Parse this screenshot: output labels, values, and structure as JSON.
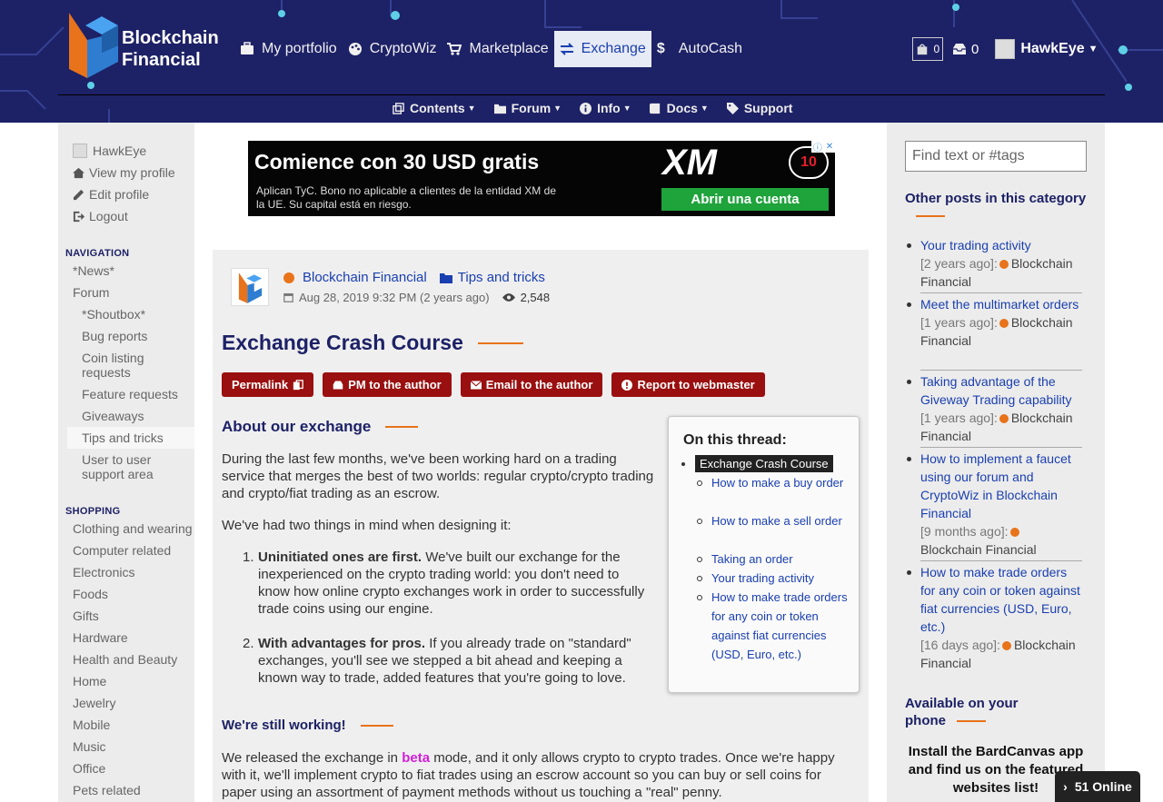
{
  "header": {
    "brand_line1": "Blockchain",
    "brand_line2": "Financial",
    "topnav": [
      {
        "label": "My portfolio",
        "icon": "briefcase-icon"
      },
      {
        "label": "CryptoWiz",
        "icon": "palette-icon"
      },
      {
        "label": "Marketplace",
        "icon": "cart-icon"
      },
      {
        "label": "Exchange",
        "icon": "exchange-icon",
        "active": true
      },
      {
        "label": "AutoCash",
        "icon": "dollar-icon"
      }
    ],
    "cart_count": "0",
    "messages_count": "0",
    "username": "HawkEye",
    "subnav": [
      {
        "label": "Contents",
        "icon": "clone-icon"
      },
      {
        "label": "Forum",
        "icon": "folder-icon"
      },
      {
        "label": "Info",
        "icon": "info-icon"
      },
      {
        "label": "Docs",
        "icon": "book-icon"
      },
      {
        "label": "Support",
        "icon": "tag-icon"
      }
    ],
    "colors": {
      "header_bg": "#1d2166",
      "accent_orange": "#e8731a",
      "button_red": "#9a0f0f"
    }
  },
  "left_sidebar": {
    "user": {
      "name": "HawkEye",
      "view_profile": "View my profile",
      "edit_profile": "Edit profile",
      "logout": "Logout"
    },
    "navigation_heading": "NAVIGATION",
    "navigation": [
      "*News*",
      "Forum",
      "*Shoutbox*",
      "Bug reports",
      "Coin listing requests",
      "Feature requests",
      "Giveaways",
      "Tips and tricks",
      "User to user support area"
    ],
    "shopping_heading": "SHOPPING",
    "shopping": [
      "Clothing and wearing",
      "Computer related",
      "Electronics",
      "Foods",
      "Gifts",
      "Hardware",
      "Health and Beauty",
      "Home",
      "Jewelry",
      "Mobile",
      "Music",
      "Office",
      "Pets related"
    ]
  },
  "ad": {
    "title": "Comience con 30 USD gratis",
    "subtitle": "Aplican TyC. Bono no aplicable a clientes de la entidad XM de la UE. Su capital está en riesgo.",
    "brand": "XM",
    "button": "Abrir una cuenta",
    "badge": "10"
  },
  "post": {
    "author": "Blockchain Financial",
    "category": "Tips and tricks",
    "date": "Aug 28, 2019 9:32 PM (2 years ago)",
    "views": "2,548",
    "title": "Exchange Crash Course",
    "buttons": {
      "permalink": "Permalink",
      "pm": "PM to the author",
      "email": "Email to the author",
      "report": "Report to webmaster"
    },
    "section1_heading": "About our exchange",
    "para1": "During the last few months, we've been working hard on a trading service that merges the best of two worlds: regular crypto/crypto trading and crypto/fiat trading as an escrow.",
    "para2": "We've had two things in mind when designing it:",
    "list": [
      {
        "bold": "Uninitiated ones are first.",
        "text": " We've built our exchange for the inexperienced on the crypto trading world: you don't need to know how online crypto exchanges work in order to successfully trade coins using our engine."
      },
      {
        "bold": "With advantages for pros.",
        "text": " If you already trade on \"standard\" exchanges, you'll see we stepped a bit ahead and keeping a known way to trade, added features that you're going to love."
      }
    ],
    "section2_heading": "We're still working!",
    "para3_pre": "We released the exchange in ",
    "para3_beta": "beta",
    "para3_post": " mode, and it only allows crypto to crypto trades. Once we're happy with it, we'll implement crypto to fiat trades using an escrow account so you can buy or sell coins for paper using an assortment of payment methods without us touching a \"real\" penny."
  },
  "thread": {
    "title": "On this thread:",
    "current": "Exchange Crash Course",
    "items": [
      "How to make a buy order",
      "How to make a sell order",
      "Taking an order",
      "Your trading activity",
      "How to make trade orders for any coin or token against fiat currencies (USD, Euro, etc.)"
    ]
  },
  "right_sidebar": {
    "search_placeholder": "Find text or #tags",
    "other_posts_heading": "Other posts in this category",
    "other_posts": [
      {
        "title": "Your trading activity",
        "when": "[2 years ago]:",
        "author": "Blockchain Financial"
      },
      {
        "title": "Meet the multimarket orders",
        "when": "[1 years ago]:",
        "author": "Blockchain Financial"
      },
      {
        "title": "Taking advantage of the Giveway Trading capability",
        "when": "[1 years ago]:",
        "author": "Blockchain Financial"
      },
      {
        "title": "How to implement a faucet using our forum and CryptoWiz in Blockchain Financial",
        "when": "[9 months ago]:",
        "author": "Blockchain Financial"
      },
      {
        "title": "How to make trade orders for any coin or token against fiat currencies (USD, Euro, etc.)",
        "when": "[16 days ago]:",
        "author": "Blockchain Financial"
      }
    ],
    "phone_heading": "Available on your phone",
    "app_text": "Install the BardCanvas app and find us on the featured websites list!"
  },
  "online_badge": "51 Online"
}
